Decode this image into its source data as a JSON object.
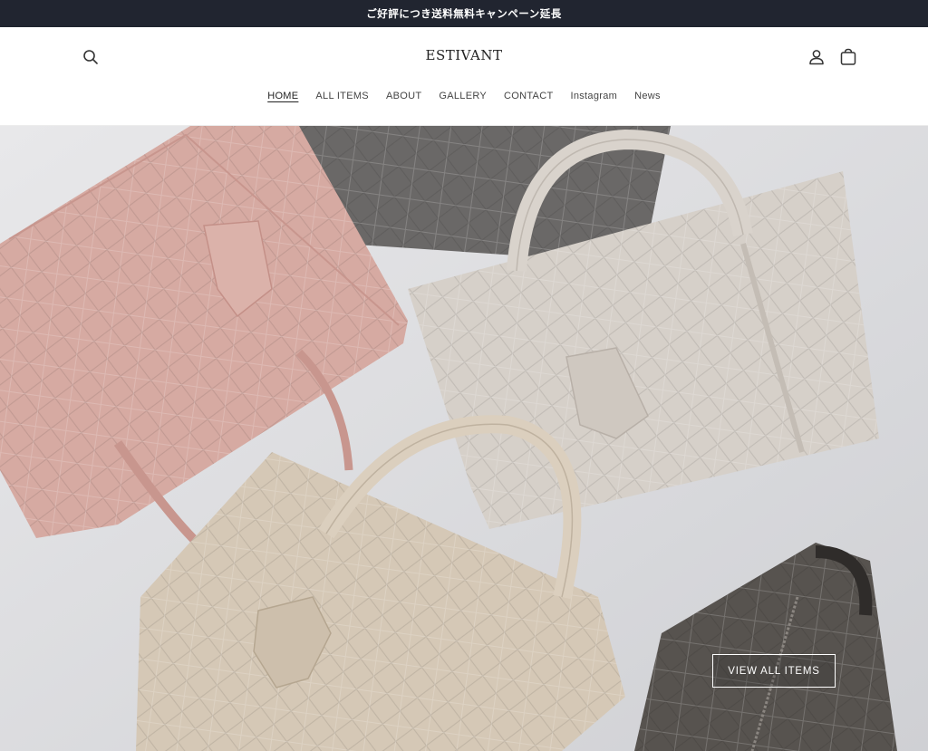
{
  "announcement": {
    "text": "ご好評につき送料無料キャンペーン延長"
  },
  "header": {
    "logo": "ESTIVANT",
    "search_icon": "search-icon",
    "account_icon": "user-icon",
    "cart_icon": "cart-icon"
  },
  "nav": {
    "items": [
      {
        "label": "HOME",
        "active": true
      },
      {
        "label": "ALL ITEMS"
      },
      {
        "label": "ABOUT"
      },
      {
        "label": "GALLERY"
      },
      {
        "label": "CONTACT"
      },
      {
        "label": "Instagram"
      },
      {
        "label": "News"
      }
    ]
  },
  "hero": {
    "cta_label": "VIEW ALL ITEMS"
  },
  "colors": {
    "announcement_bg": "#212530",
    "bag_pink": "#d9aea6",
    "bag_light_gray": "#d8d2cb",
    "bag_beige": "#d5c8b8",
    "bag_dark": "#5a5755"
  }
}
